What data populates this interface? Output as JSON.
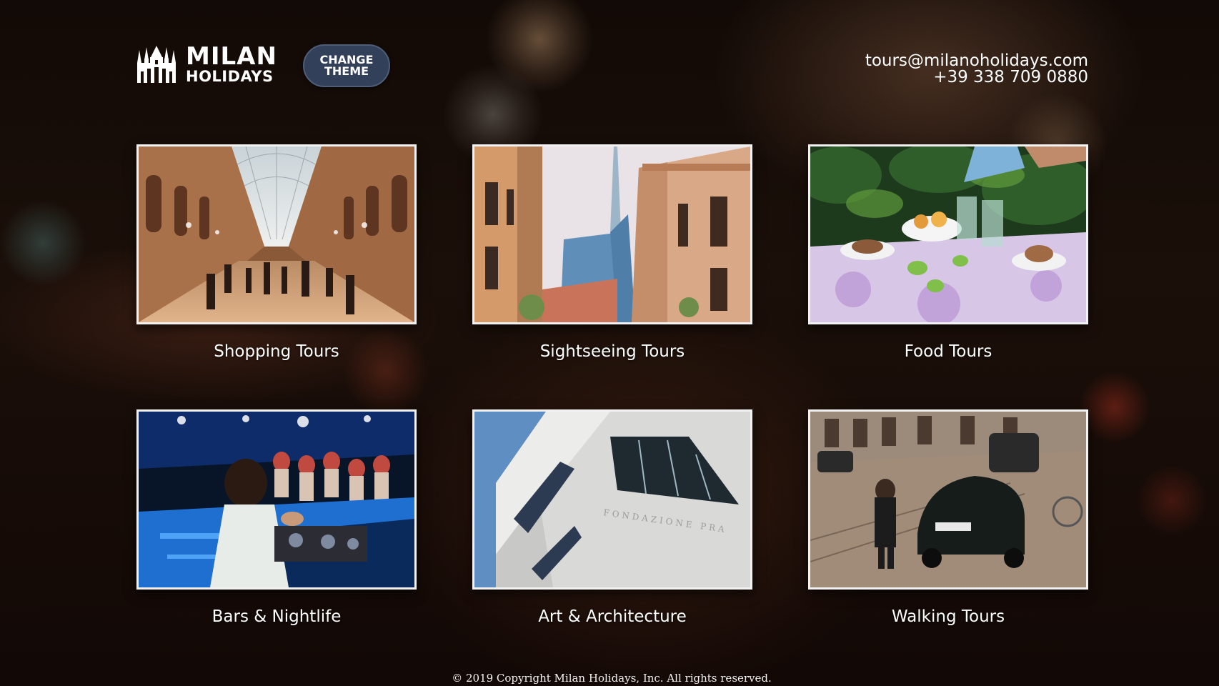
{
  "brand": {
    "line1": "MILAN",
    "line2": "HOLIDAYS",
    "icon": "duomo-icon"
  },
  "header": {
    "theme_button": [
      "CHANGE",
      "THEME"
    ],
    "email": "tours@milanoholidays.com",
    "phone": "+39 338 709 0880"
  },
  "tours": [
    {
      "label": "Shopping Tours",
      "icon": "galleria-photo"
    },
    {
      "label": "Sightseeing Tours",
      "icon": "skyline-photo"
    },
    {
      "label": "Food Tours",
      "icon": "food-table-photo"
    },
    {
      "label": "Bars & Nightlife",
      "icon": "dj-concert-photo"
    },
    {
      "label": "Art & Architecture",
      "icon": "modern-building-photo"
    },
    {
      "label": "Walking Tours",
      "icon": "street-car-photo"
    }
  ],
  "footer": {
    "copyright": "© 2019 Copyright Milan Holidays, Inc. All rights reserved."
  },
  "colors": {
    "button_bg": "#33405a",
    "frame": "#f2f2f2",
    "text": "#ffffff"
  }
}
